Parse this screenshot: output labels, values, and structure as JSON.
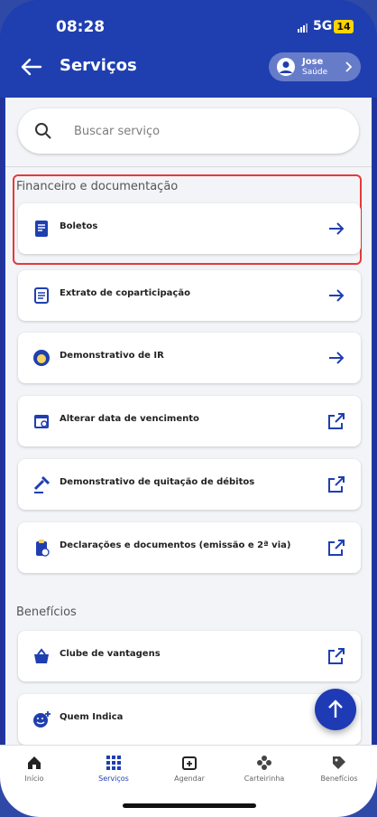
{
  "status": {
    "time": "08:28",
    "network": "5G",
    "battery": "14"
  },
  "header": {
    "title": "Serviços",
    "user_name": "Jose",
    "user_plan": "Saúde"
  },
  "search": {
    "placeholder": "Buscar serviço"
  },
  "sections": {
    "finance": "Financeiro e documentação",
    "benefits": "Benefícios"
  },
  "items": [
    {
      "label": "Boletos",
      "icon": "invoice-icon",
      "action": "arrow-right-icon"
    },
    {
      "label": "Extrato de coparticipação",
      "icon": "document-icon",
      "action": "arrow-right-icon"
    },
    {
      "label": "Demonstrativo de IR",
      "icon": "lion-icon",
      "action": "arrow-right-icon"
    },
    {
      "label": "Alterar data de vencimento",
      "icon": "calendar-refresh-icon",
      "action": "external-link-icon"
    },
    {
      "label": "Demonstrativo de quitação de débitos",
      "icon": "gavel-icon",
      "action": "external-link-icon"
    },
    {
      "label": "Declarações e documentos (emissão e 2ª via)",
      "icon": "clipboard-clock-icon",
      "action": "external-link-icon"
    },
    {
      "label": "Clube de vantagens",
      "icon": "basket-icon",
      "action": "external-link-icon"
    },
    {
      "label": "Quem Indica",
      "icon": "smile-plus-icon",
      "action": ""
    }
  ],
  "nav": [
    {
      "label": "Início",
      "icon": "home-icon"
    },
    {
      "label": "Serviços",
      "icon": "grid-icon"
    },
    {
      "label": "Agendar",
      "icon": "calendar-add-icon"
    },
    {
      "label": "Carteirinha",
      "icon": "flower-icon"
    },
    {
      "label": "Benefícios",
      "icon": "tag-icon"
    }
  ],
  "colors": {
    "primary": "#1f3fb0",
    "highlight": "#e53a3a"
  }
}
